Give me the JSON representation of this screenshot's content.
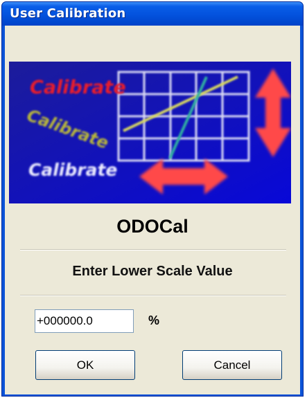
{
  "window": {
    "title": "User Calibration"
  },
  "banner": {
    "words": [
      "Calibrate",
      "Calibrate",
      "Calibrate"
    ]
  },
  "app": {
    "name": "ODOCal"
  },
  "prompt": "Enter Lower Scale Value",
  "input": {
    "value": "+000000.0",
    "unit": "%"
  },
  "buttons": {
    "ok": "OK",
    "cancel": "Cancel"
  },
  "colors": {
    "titlebar": "#0352dd",
    "dialog_bg": "#ece9d8",
    "banner_bg": "#1a1aa8",
    "arrow": "#ff3a3a"
  }
}
